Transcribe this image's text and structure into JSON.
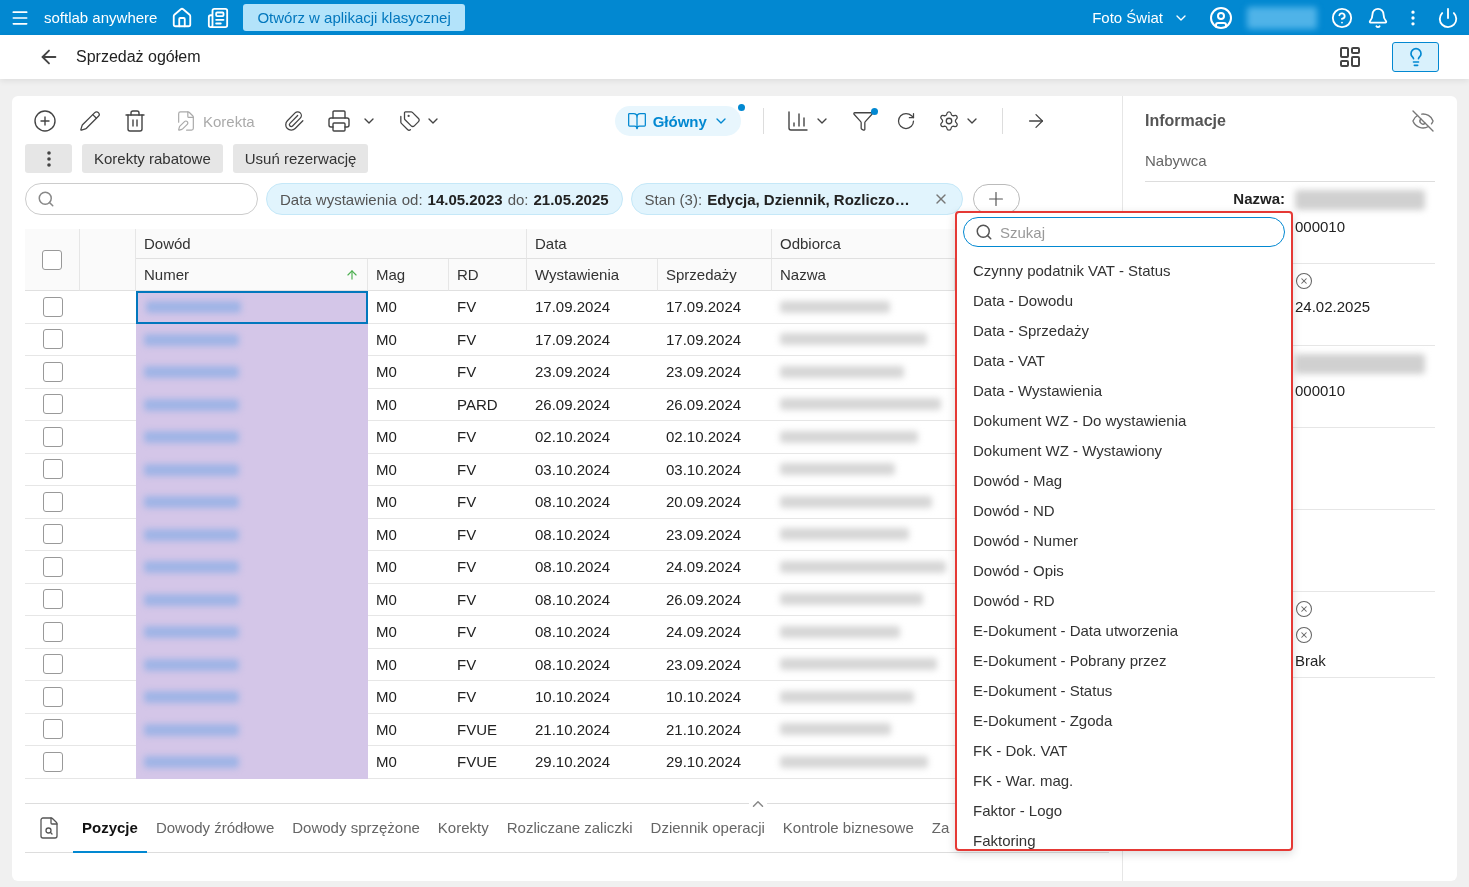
{
  "topbar": {
    "app_name": "softlab anywhere",
    "open_classic": "Otwórz w aplikacji klasycznej",
    "company": "Foto Świat"
  },
  "header": {
    "title": "Sprzedaż ogółem",
    "lightbulb_active": true
  },
  "toolbar": {
    "correction": "Korekta",
    "view": "Główny",
    "view_modified": true,
    "filter_active": true,
    "buttons": [
      "Korekty rabatowe",
      "Usuń rezerwację"
    ]
  },
  "filters": [
    {
      "kind": "range",
      "label": "Data wystawienia",
      "from_label": "od:",
      "from": "14.05.2023",
      "to_label": "do:",
      "to": "21.05.2025"
    },
    {
      "kind": "list",
      "label": "Stan (3):",
      "value": "Edycja, Dziennik, Rozliczo…"
    }
  ],
  "table": {
    "all_checked": false,
    "groups": [
      {
        "label": "Dowód"
      },
      {
        "label": "Data"
      },
      {
        "label": "Odbiorca"
      }
    ],
    "columns": [
      {
        "label": "Numer",
        "sorted": true
      },
      {
        "label": "Mag",
        "sorted": false
      },
      {
        "label": "RD",
        "sorted": false
      },
      {
        "label": "Wystawienia",
        "sorted": false
      },
      {
        "label": "Sprzedaży",
        "sorted": false
      },
      {
        "label": "Nazwa",
        "sorted": false
      }
    ],
    "rows": [
      {
        "checked": false,
        "focused": true,
        "mag": "M0",
        "rd": "FV",
        "issued": "17.09.2024",
        "sold": "17.09.2024"
      },
      {
        "checked": false,
        "focused": false,
        "mag": "M0",
        "rd": "FV",
        "issued": "17.09.2024",
        "sold": "17.09.2024"
      },
      {
        "checked": false,
        "focused": false,
        "mag": "M0",
        "rd": "FV",
        "issued": "23.09.2024",
        "sold": "23.09.2024"
      },
      {
        "checked": false,
        "focused": false,
        "mag": "M0",
        "rd": "PARD",
        "issued": "26.09.2024",
        "sold": "26.09.2024"
      },
      {
        "checked": false,
        "focused": false,
        "mag": "M0",
        "rd": "FV",
        "issued": "02.10.2024",
        "sold": "02.10.2024"
      },
      {
        "checked": false,
        "focused": false,
        "mag": "M0",
        "rd": "FV",
        "issued": "03.10.2024",
        "sold": "03.10.2024"
      },
      {
        "checked": false,
        "focused": false,
        "mag": "M0",
        "rd": "FV",
        "issued": "08.10.2024",
        "sold": "20.09.2024"
      },
      {
        "checked": false,
        "focused": false,
        "mag": "M0",
        "rd": "FV",
        "issued": "08.10.2024",
        "sold": "23.09.2024"
      },
      {
        "checked": false,
        "focused": false,
        "mag": "M0",
        "rd": "FV",
        "issued": "08.10.2024",
        "sold": "24.09.2024"
      },
      {
        "checked": false,
        "focused": false,
        "mag": "M0",
        "rd": "FV",
        "issued": "08.10.2024",
        "sold": "26.09.2024"
      },
      {
        "checked": false,
        "focused": false,
        "mag": "M0",
        "rd": "FV",
        "issued": "08.10.2024",
        "sold": "24.09.2024"
      },
      {
        "checked": false,
        "focused": false,
        "mag": "M0",
        "rd": "FV",
        "issued": "08.10.2024",
        "sold": "23.09.2024"
      },
      {
        "checked": false,
        "focused": false,
        "mag": "M0",
        "rd": "FV",
        "issued": "10.10.2024",
        "sold": "10.10.2024"
      },
      {
        "checked": false,
        "focused": false,
        "mag": "M0",
        "rd": "FVUE",
        "issued": "21.10.2024",
        "sold": "21.10.2024"
      },
      {
        "checked": false,
        "focused": false,
        "mag": "M0",
        "rd": "FVUE",
        "issued": "29.10.2024",
        "sold": "29.10.2024"
      }
    ]
  },
  "bottom_tabs": [
    {
      "label": "Pozycje",
      "selected": true
    },
    {
      "label": "Dowody źródłowe",
      "selected": false
    },
    {
      "label": "Dowody sprzężone",
      "selected": false
    },
    {
      "label": "Korekty",
      "selected": false
    },
    {
      "label": "Rozliczane zaliczki",
      "selected": false
    },
    {
      "label": "Dziennik operacji",
      "selected": false
    },
    {
      "label": "Kontrole biznesowe",
      "selected": false
    },
    {
      "label": "Za",
      "selected": false
    }
  ],
  "column_picker": {
    "placeholder": "Szukaj",
    "items": [
      "Czynny podatnik VAT - Status",
      "Data - Dowodu",
      "Data - Sprzedaży",
      "Data - VAT",
      "Data - Wystawienia",
      "Dokument WZ - Do wystawienia",
      "Dokument WZ - Wystawiony",
      "Dowód - Mag",
      "Dowód - ND",
      "Dowód - Numer",
      "Dowód - Opis",
      "Dowód - RD",
      "E-Dokument - Data utworzenia",
      "E-Dokument - Pobrany przez",
      "E-Dokument - Status",
      "E-Dokument - Zgoda",
      "FK - Dok. VAT",
      "FK - War. mag.",
      "Faktor - Logo",
      "Faktoring"
    ]
  },
  "info": {
    "title": "Informacje",
    "section": "Nabywca",
    "blocks": [
      {
        "kind": "values",
        "label": "Nazwa:",
        "items": [
          {
            "kind": "redacted"
          },
          {
            "kind": "text",
            "text": "000010"
          }
        ]
      },
      {
        "kind": "values",
        "items": [
          {
            "kind": "clear"
          },
          {
            "kind": "text",
            "text": "24.02.2025"
          }
        ]
      },
      {
        "kind": "values",
        "items": [
          {
            "kind": "redacted"
          },
          {
            "kind": "text",
            "text": "000010"
          }
        ]
      },
      {
        "kind": "empty"
      },
      {
        "kind": "empty"
      },
      {
        "kind": "values",
        "items": [
          {
            "kind": "clear"
          },
          {
            "kind": "clear"
          },
          {
            "kind": "text",
            "text": "Brak"
          }
        ]
      }
    ]
  }
}
